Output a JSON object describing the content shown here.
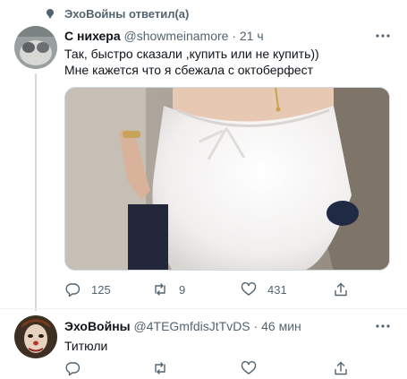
{
  "context": {
    "text": "ЭхоВойны ответил(а)",
    "icon": "retweet-context-icon"
  },
  "tweets": [
    {
      "author_name": "С нихера",
      "handle": "@showmeinamore",
      "separator": "·",
      "time": "21 ч",
      "lines": [
        "Так, быстро сказали ,купить или не купить))",
        "Мне кажется что я сбежала с октоберфест"
      ],
      "has_media": true,
      "actions": {
        "reply": "125",
        "retweet": "9",
        "like": "431"
      }
    },
    {
      "author_name": "ЭхоВойны",
      "handle": "@4TEGmfdisJtTvDS",
      "separator": "·",
      "time": "46 мин",
      "lines": [
        "Титюли"
      ],
      "has_media": false,
      "actions": {
        "reply": "",
        "retweet": "",
        "like": ""
      }
    }
  ],
  "colors": {
    "text": "#0f1419",
    "secondary": "#536471",
    "border": "#cfd9de"
  }
}
